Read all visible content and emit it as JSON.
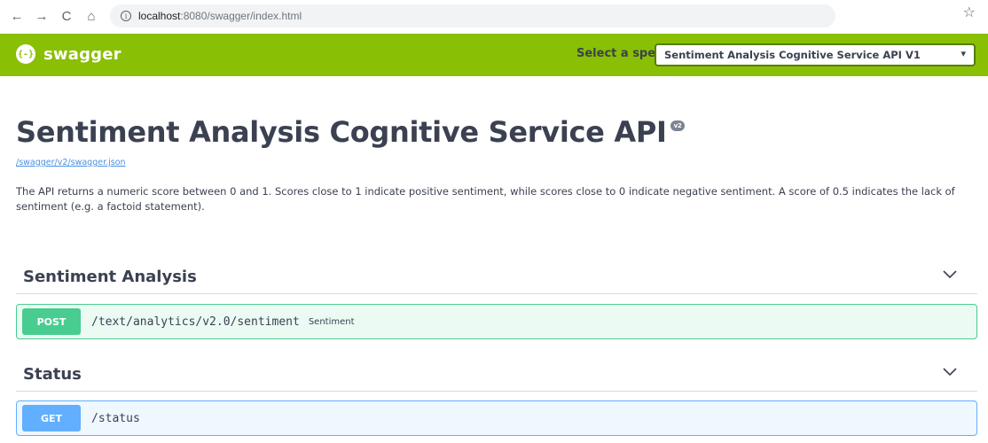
{
  "browser": {
    "back_glyph": "←",
    "forward_glyph": "→",
    "reload_glyph": "C",
    "home_glyph": "⌂",
    "url_host": "localhost",
    "url_path": ":8080/swagger/index.html",
    "info_glyph": "i",
    "star_glyph": "☆"
  },
  "topbar": {
    "logo_mark": "{-}",
    "logo_text": "swagger",
    "select_label": "Select a spec",
    "selected_spec": "Sentiment Analysis Cognitive Service API V1",
    "chevron_glyph": "⌄",
    "background": "#89bf04"
  },
  "info": {
    "title": "Sentiment Analysis Cognitive Service API",
    "version_badge": "v2",
    "spec_url": "/swagger/v2/swagger.json",
    "description": "The API returns a numeric score between 0 and 1. Scores close to 1 indicate positive sentiment, while scores close to 0 indicate negative sentiment. A score of 0.5 indicates the lack of sentiment (e.g. a factoid statement)."
  },
  "tags": [
    {
      "name": "Sentiment Analysis",
      "operations": [
        {
          "method": "POST",
          "path": "/text/analytics/v2.0/sentiment",
          "summary": "Sentiment",
          "color": "#49cc90"
        }
      ]
    },
    {
      "name": "Status",
      "operations": [
        {
          "method": "GET",
          "path": "/status",
          "summary": "",
          "color": "#61affe"
        }
      ]
    }
  ],
  "icons": {
    "back": "arrow-left-icon",
    "forward": "arrow-right-icon",
    "reload": "reload-icon",
    "home": "home-icon",
    "info": "info-icon",
    "star": "star-icon",
    "logo": "swagger-logo-icon",
    "chevron": "chevron-down-icon"
  }
}
